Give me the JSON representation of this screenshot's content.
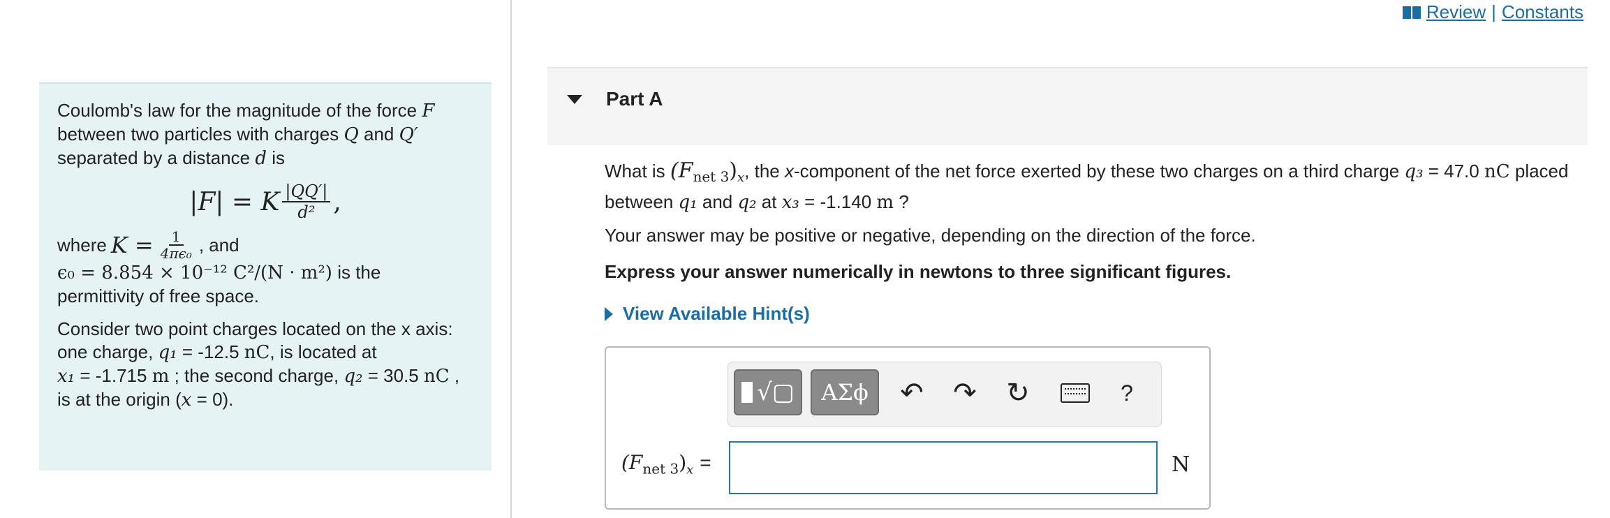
{
  "links": {
    "review": "Review",
    "separator": "|",
    "constants": "Constants"
  },
  "info": {
    "line1": "Coulomb's law for the magnitude of the force",
    "var_F": "F",
    "line2a": "between two particles with charges",
    "var_Q": "Q",
    "and": "and",
    "var_Qp": "Q′",
    "line3": "separated by a distance",
    "var_d": "d",
    "is": "is",
    "eq_lhs": "|F| = K",
    "eq_num": "|QQ′|",
    "eq_den": "d²",
    "eq_comma": ",",
    "where": "where",
    "K_eq": "K =",
    "K_num": "1",
    "K_den": "4πϵ₀",
    "K_and": ", and",
    "eps_value": "ϵ₀ = 8.854 × 10⁻¹² C²/(N · m²)",
    "eps_is": "is the",
    "eps_tail": "permittivity of free space.",
    "p2_l1": "Consider two point charges located on the x axis:",
    "p2_l2a": "one charge,",
    "q1": "q₁",
    "q1_val": "= -12.5",
    "nC": "nC",
    "p2_l2b": ", is located at",
    "x1": "x₁",
    "x1_val": "= -1.715",
    "m": "m",
    "p2_l3b": "; the second charge,",
    "q2": "q₂",
    "q2_val": "= 30.5",
    "comma": ",",
    "p2_l4": "is at the origin (",
    "x_eq": "x",
    "zero": "= 0).",
    "end": ""
  },
  "part": {
    "label": "Part A"
  },
  "question": {
    "l1a": "What is",
    "fnet": "(F",
    "fnet_sub": "net 3",
    "fnet_close": ")",
    "fnet_x": "x",
    "l1b": ", the",
    "l1c": "x",
    "l1d": "-component of the net force exerted by these two charges on a third charge",
    "q3": "q₃",
    "q3_val": "= 47.0",
    "nC": "nC",
    "placed": "placed",
    "l2a": "between",
    "q1": "q₁",
    "and": "and",
    "q2": "q₂",
    "at": "at",
    "x3": "x₃",
    "x3_val": "= -1.140",
    "m": "m",
    "qmark": "?",
    "line2": "Your answer may be positive or negative, depending on the direction of the force.",
    "line3": "Express your answer numerically in newtons to three significant figures.",
    "hint": "View Available Hint(s)"
  },
  "answer": {
    "label_open": "(F",
    "label_sub": "net 3",
    "label_close": ")",
    "label_x": "x",
    "label_eq": "=",
    "value": "",
    "unit": "N",
    "greek_label": "ΑΣϕ",
    "help": "?"
  }
}
